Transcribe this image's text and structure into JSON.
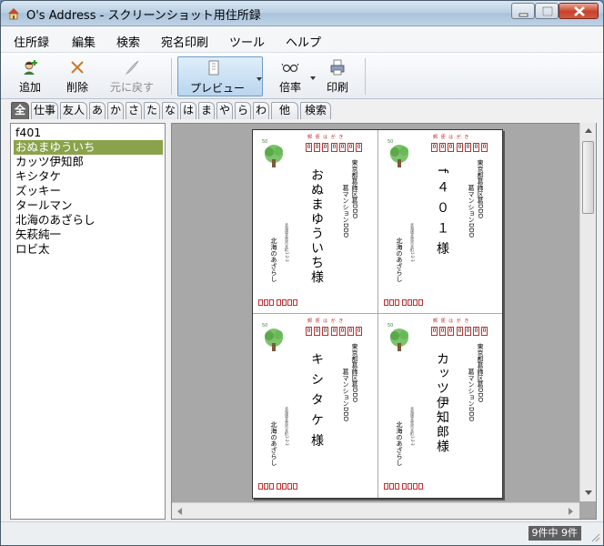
{
  "window": {
    "title": "O's Address - スクリーンショット用住所録"
  },
  "menu": {
    "items": [
      "住所録",
      "編集",
      "検索",
      "宛名印刷",
      "ツール",
      "ヘルプ"
    ]
  },
  "toolbar": {
    "add_label": "追加",
    "delete_label": "削除",
    "undo_label": "元に戻す",
    "preview_label": "プレビュー",
    "zoom_label": "倍率",
    "print_label": "印刷"
  },
  "tabs": [
    "全",
    "仕事",
    "友人",
    "あ",
    "か",
    "さ",
    "た",
    "な",
    "は",
    "ま",
    "や",
    "ら",
    "わ",
    "他",
    "検索"
  ],
  "contacts": [
    "f401",
    "おぬまゆういち",
    "カッツ伊知郎",
    "キシタケ",
    "ズッキー",
    "タールマン",
    "北海のあざらし",
    "矢萩純一",
    "ロビ太"
  ],
  "selected_index": 1,
  "preview": {
    "top_mark": "郵 便 は が き",
    "stamp_label": "50",
    "zip": [
      "0",
      "0",
      "0",
      "0",
      "0",
      "0",
      "0"
    ],
    "address_line1": "東京都葛飾区葛DDD",
    "address_line2": "葛マンションDDD",
    "sender_name": "北海のあざらし",
    "sender_address": "北海道北見市北町1-2-3",
    "cards": [
      {
        "recipient": "おぬまゆういち様"
      },
      {
        "recipient": "f ４ ０ １ 様"
      },
      {
        "recipient": "キ シ タ ケ 様"
      },
      {
        "recipient": "カッツ伊知郎様"
      }
    ]
  },
  "status": {
    "count_text": "9件中 9件"
  }
}
